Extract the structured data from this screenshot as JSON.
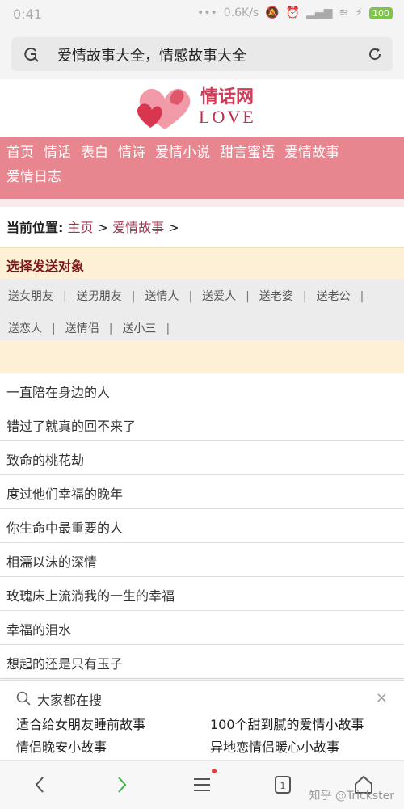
{
  "status": {
    "time": "0:41",
    "net": "0.6K/s",
    "battery": "100"
  },
  "urlbar": {
    "title": "爱情故事大全，情感故事大全"
  },
  "logo": {
    "name": "情话网",
    "love": "LOVE"
  },
  "nav": {
    "items": [
      "首页",
      "情话",
      "表白",
      "情诗",
      "爱情小说",
      "甜言蜜语",
      "爱情故事",
      "爱情日志"
    ]
  },
  "breadcrumb": {
    "label": "当前位置:",
    "home": "主页",
    "sep1": " > ",
    "current": "爱情故事",
    "sep2": " >"
  },
  "select": {
    "heading": "选择发送对象",
    "tags": [
      "送女朋友",
      "送男朋友",
      "送情人",
      "送爱人",
      "送老婆",
      "送老公",
      "送恋人",
      "送情侣",
      "送小三"
    ],
    "separator": "|"
  },
  "stories": [
    "一直陪在身边的人",
    "错过了就真的回不来了",
    "致命的桃花劫",
    "度过他们幸福的晚年",
    "你生命中最重要的人",
    "相濡以沫的深情",
    "玫瑰床上流淌我的一生的幸福",
    "幸福的泪水",
    "想起的还是只有玉子"
  ],
  "popup": {
    "title": "大家都在搜",
    "close": "×",
    "queries": [
      "适合给女朋友睡前故事",
      "100个甜到腻的爱情小故事",
      "情侣晚安小故事",
      "异地恋情侣暖心小故事"
    ]
  },
  "bottombar": {
    "tabs_count": "1"
  },
  "watermark": "知乎 @Trickster",
  "colors": {
    "nav_bg": "#e8868f",
    "select_bg": "#fdf0d6",
    "link": "#a3324c"
  }
}
